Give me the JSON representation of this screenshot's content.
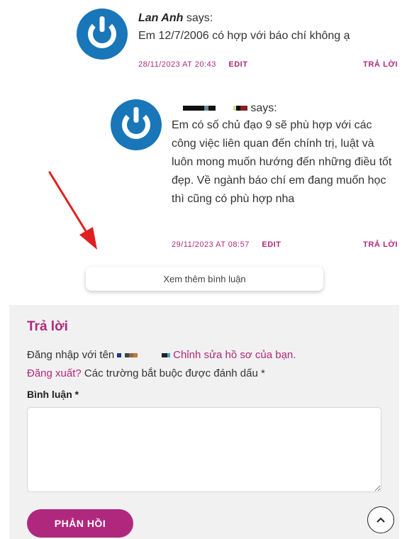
{
  "comment1": {
    "author": "Lan Anh",
    "says": "says:",
    "text": "Em 12/7/2006 có hợp với báo chí không ạ",
    "date": "28/11/2023 AT 20:43",
    "edit": "EDIT",
    "reply": "TRẢ LỜI"
  },
  "comment2": {
    "says": "says:",
    "text": "Em có số chủ đạo 9 sẽ phù hợp với các công việc liên quan đến chính trị, luật và luôn mong muốn hướng đến những điều tốt đẹp. Về ngành báo chí em đang muốn học thì cũng có phù hợp nha",
    "date": "29/11/2023 AT 08:57",
    "edit": "EDIT",
    "reply": "TRẢ LỜI"
  },
  "more_button": "Xem thêm bình luận",
  "reply_form": {
    "title": "Trả lời",
    "logged_prefix": "Đăng nhập với tên",
    "edit_profile": "Chỉnh sửa hồ sơ của bạn.",
    "logout": "Đăng xuất?",
    "required_note": "Các trường bắt buộc được đánh dấu *",
    "comment_label": "Bình luận *",
    "comment_value": "",
    "submit": "PHẢN HỒI"
  },
  "colors": {
    "accent": "#b0287e",
    "avatar": "#1976b8",
    "annotation_arrow": "#e02020",
    "form_bg": "#f1f1f1"
  },
  "icons": {
    "avatar": "power-avatar-icon",
    "scroll_top": "chevron-up-icon",
    "annotation": "red-arrow-icon"
  }
}
